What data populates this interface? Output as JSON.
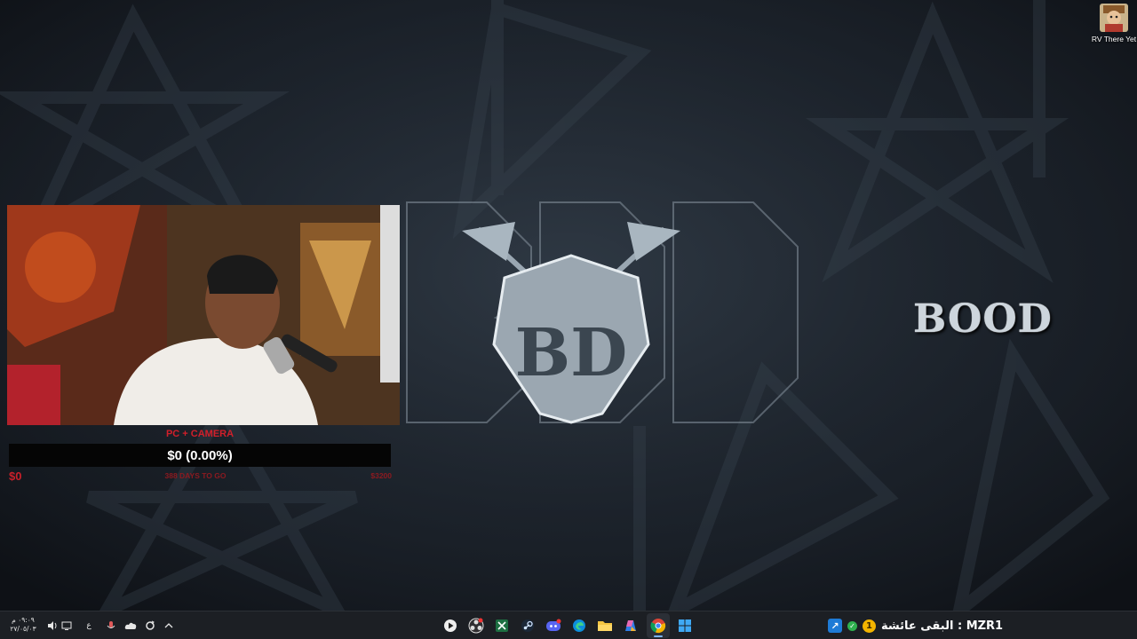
{
  "desktop": {
    "shortcut": {
      "label": "RV There Yet",
      "icon": "game-avatar-icon"
    },
    "brand_text": "BOOD",
    "logo_monogram": "BD",
    "background_color": "#1c232c"
  },
  "donation_goal": {
    "title": "PC + CAMERA",
    "amount_text": "$0 (0.00%)",
    "progress_percent": 0,
    "start_label": "$0",
    "days_label": "388 DAYS TO GO",
    "target_label": "$3200",
    "accent_color": "#d21f2a"
  },
  "taskbar": {
    "clock_time": "٠٩:٠٩ م",
    "clock_date": "٢٧/٠٥/٠٣",
    "language": "ع",
    "tray_icons": [
      "speaker-icon",
      "network-icon",
      "microphone-icon",
      "onedrive-icon",
      "sync-icon",
      "chevron-up-icon"
    ],
    "apps": [
      "media-player-icon",
      "obs-icon",
      "excel-icon",
      "steam-icon",
      "discord-icon",
      "edge-icon",
      "file-explorer-icon",
      "copilot-icon",
      "chrome-icon",
      "windows-start-icon"
    ],
    "widget": {
      "text": "البقى عائشة : MZR1",
      "coin_label": "1"
    }
  }
}
